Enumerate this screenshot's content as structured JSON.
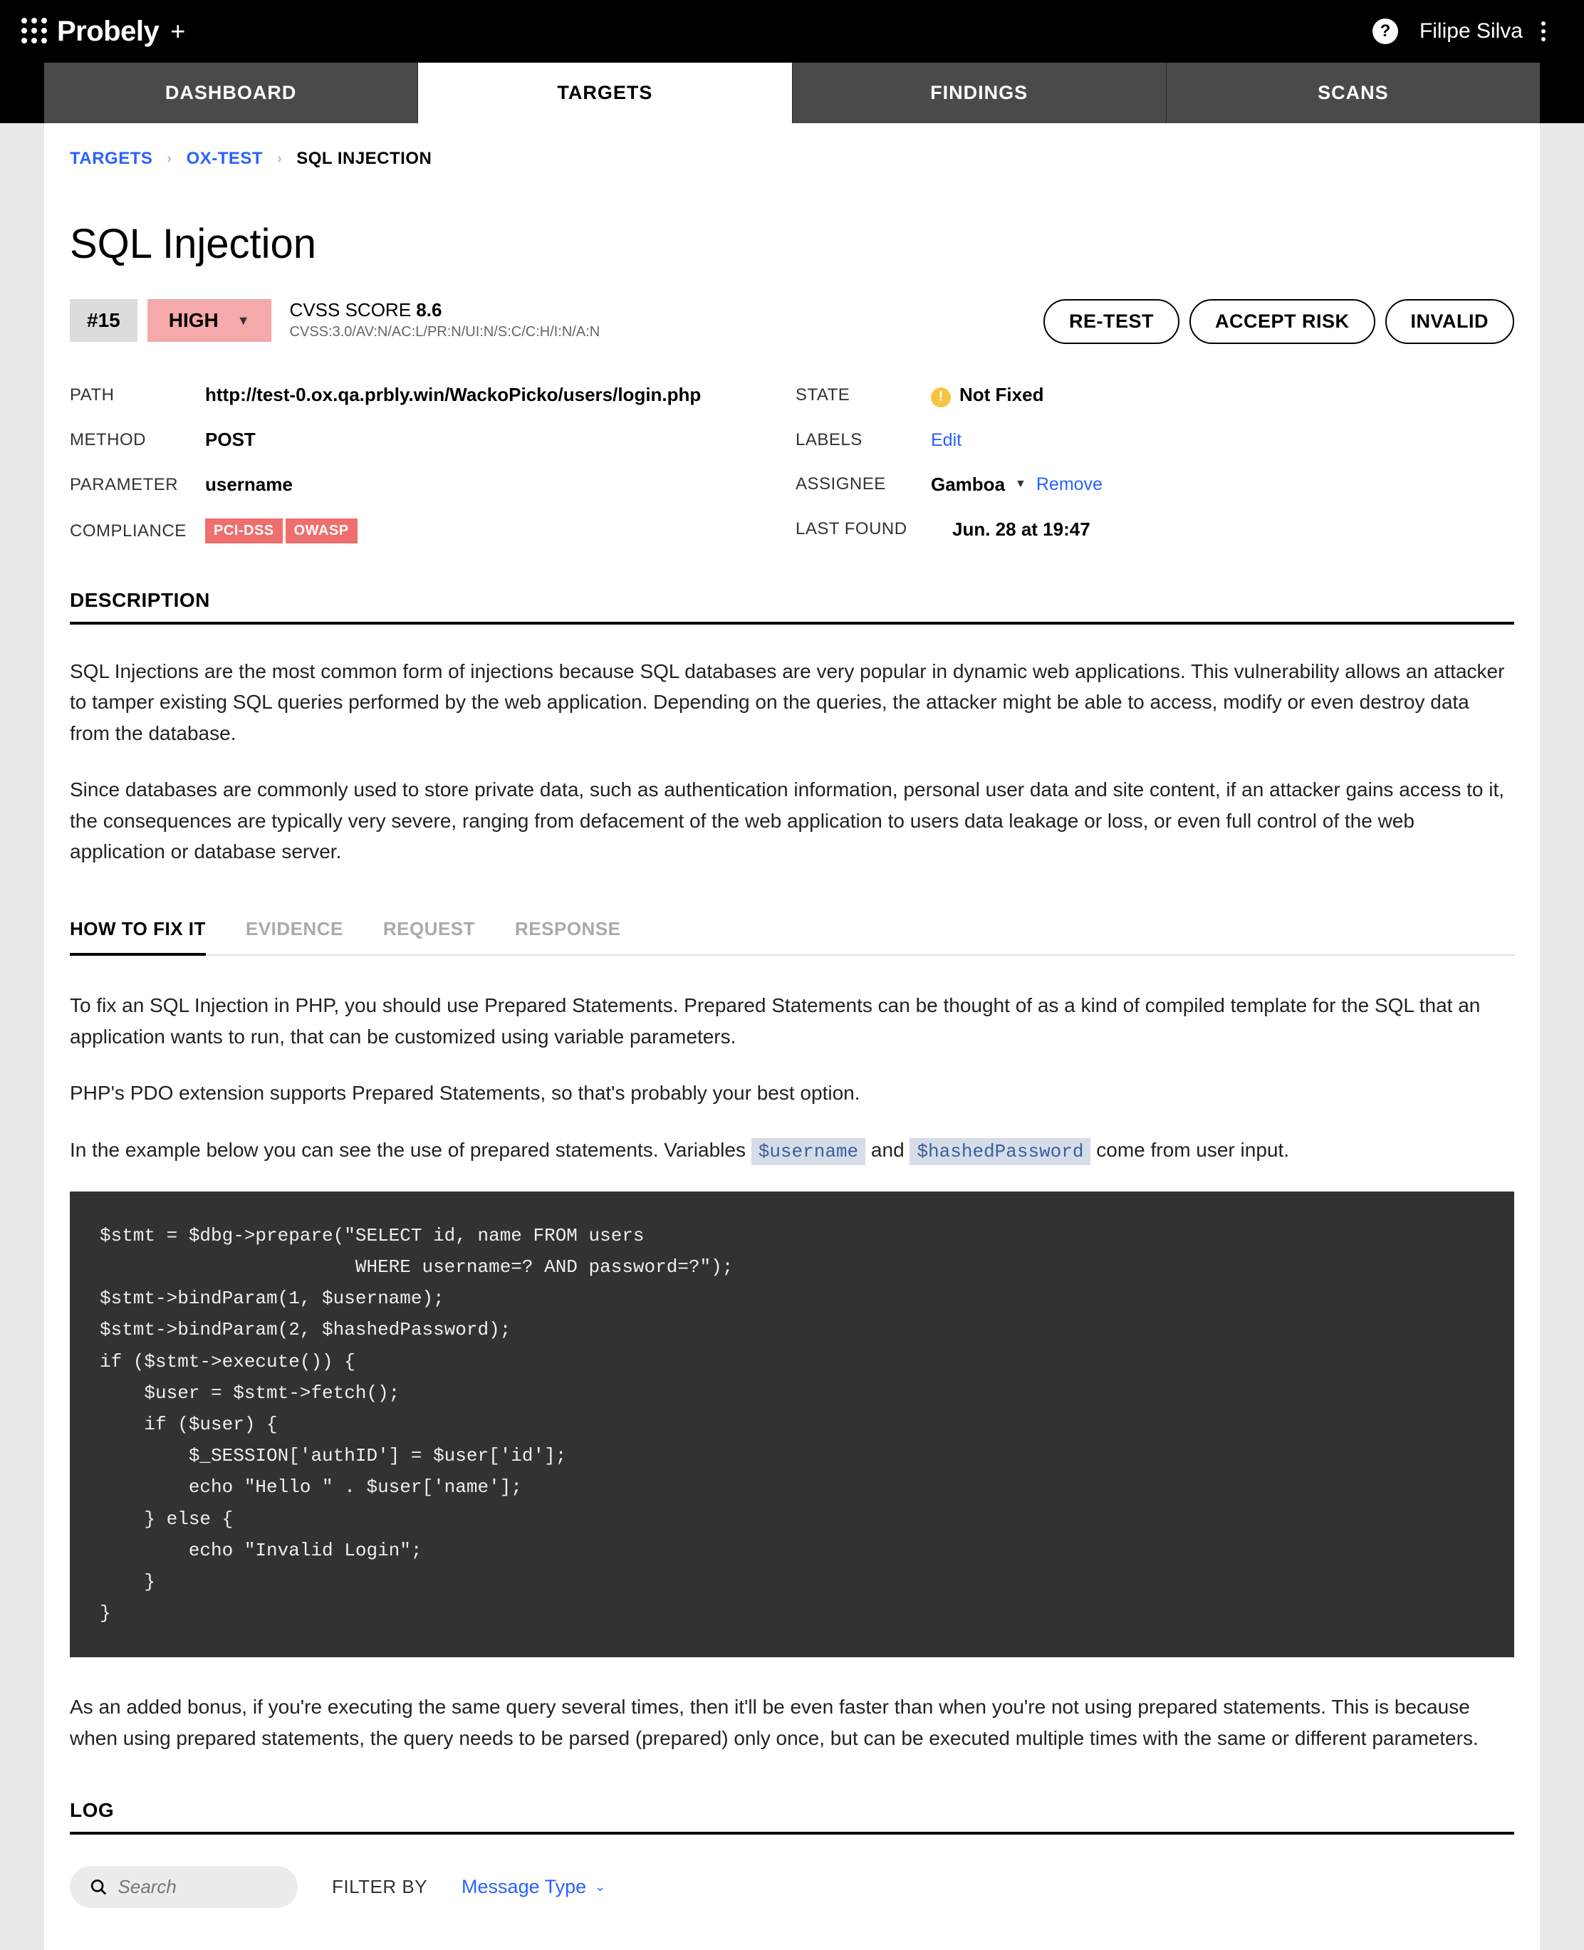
{
  "brand": {
    "name": "Probely",
    "plus": "+"
  },
  "user": {
    "name": "Filipe Silva"
  },
  "nav": {
    "dashboard": "DASHBOARD",
    "targets": "TARGETS",
    "findings": "FINDINGS",
    "scans": "SCANS"
  },
  "breadcrumb": {
    "targets": "TARGETS",
    "project": "OX-TEST",
    "current": "SQL INJECTION"
  },
  "page_title": "SQL Injection",
  "finding": {
    "hash": "#15",
    "severity": "HIGH",
    "cvss_label": "CVSS SCORE",
    "cvss_score": "8.6",
    "cvss_vector": "CVSS:3.0/AV:N/AC:L/PR:N/UI:N/S:C/C:H/I:N/A:N"
  },
  "actions": {
    "retest": "RE-TEST",
    "accept": "ACCEPT RISK",
    "invalid": "INVALID"
  },
  "left": {
    "path_label": "PATH",
    "path_value": "http://test-0.ox.qa.prbly.win/WackoPicko/users/login.php",
    "method_label": "METHOD",
    "method_value": "POST",
    "param_label": "PARAMETER",
    "param_value": "username",
    "compliance_label": "COMPLIANCE",
    "compliance_pci": "PCI-DSS",
    "compliance_owasp": "OWASP"
  },
  "right": {
    "state_label": "STATE",
    "state_value": "Not Fixed",
    "labels_label": "LABELS",
    "labels_edit": "Edit",
    "assignee_label": "ASSIGNEE",
    "assignee_value": "Gamboa",
    "assignee_remove": "Remove",
    "lastfound_label": "LAST FOUND",
    "lastfound_value": "Jun. 28 at 19:47"
  },
  "sections": {
    "description": "DESCRIPTION",
    "log": "LOG"
  },
  "description_p1": "SQL Injections are the most common form of injections because SQL databases are very popular in dynamic web applications. This vulnerability allows an attacker to tamper existing SQL queries performed by the web application. Depending on the queries, the attacker might be able to access, modify or even destroy data from the database.",
  "description_p2": "Since databases are commonly used to store private data, such as authentication information, personal user data and site content, if an attacker gains access to it, the consequences are typically very severe, ranging from defacement of the web application to users data leakage or loss, or even full control of the web application or database server.",
  "subtabs": {
    "howto": "HOW TO FIX IT",
    "evidence": "EVIDENCE",
    "request": "REQUEST",
    "response": "RESPONSE"
  },
  "fix": {
    "p1": "To fix an SQL Injection in PHP, you should use Prepared Statements. Prepared Statements can be thought of as a kind of compiled template for the SQL that an application wants to run, that can be customized using variable parameters.",
    "p2": "PHP's PDO extension supports Prepared Statements, so that's probably your best option.",
    "p3a": "In the example below you can see the use of prepared statements. Variables ",
    "var1": "$username",
    "p3b": " and ",
    "var2": "$hashedPassword",
    "p3c": " come from user input.",
    "code": "$stmt = $dbg->prepare(\"SELECT id, name FROM users\n                       WHERE username=? AND password=?\");\n$stmt->bindParam(1, $username);\n$stmt->bindParam(2, $hashedPassword);\nif ($stmt->execute()) {\n    $user = $stmt->fetch();\n    if ($user) {\n        $_SESSION['authID'] = $user['id'];\n        echo \"Hello \" . $user['name'];\n    } else {\n        echo \"Invalid Login\";\n    }\n}",
    "p4": "As an added bonus, if you're executing the same query several times, then it'll be even faster than when you're not using prepared statements. This is because when using prepared statements, the query needs to be parsed (prepared) only once, but can be executed multiple times with the same or different parameters."
  },
  "log": {
    "search_placeholder": "Search",
    "filter_label": "FILTER BY",
    "filter_value": "Message Type"
  }
}
